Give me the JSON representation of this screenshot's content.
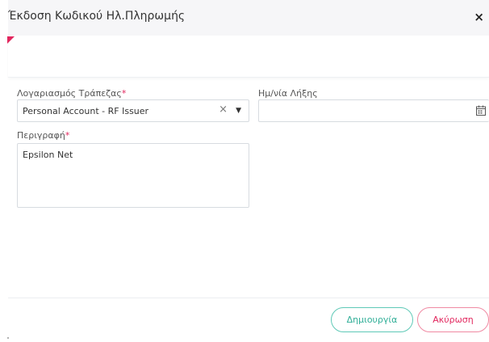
{
  "dialog": {
    "title": "Έκδοση Κωδικού Ηλ.Πληρωμής",
    "close_label": "×"
  },
  "form": {
    "bank_account": {
      "label": "Λογαριασμός Τράπεζας",
      "required_mark": "*",
      "value": "Personal Account - RF Issuer",
      "clear_label": "×",
      "caret_label": "▼"
    },
    "expiry_date": {
      "label": "Ημ/νία Λήξης",
      "value": "",
      "icon": "calendar-icon"
    },
    "description": {
      "label": "Περιγραφή",
      "required_mark": "*",
      "value": "Epsilon Net"
    }
  },
  "footer": {
    "create_label": "Δημιουργία",
    "cancel_label": "Ακύρωση"
  },
  "colors": {
    "accent_required": "#e2275e",
    "create_button": "#2fae97",
    "cancel_button": "#e2275e",
    "header_background": "#f6f6f8"
  }
}
